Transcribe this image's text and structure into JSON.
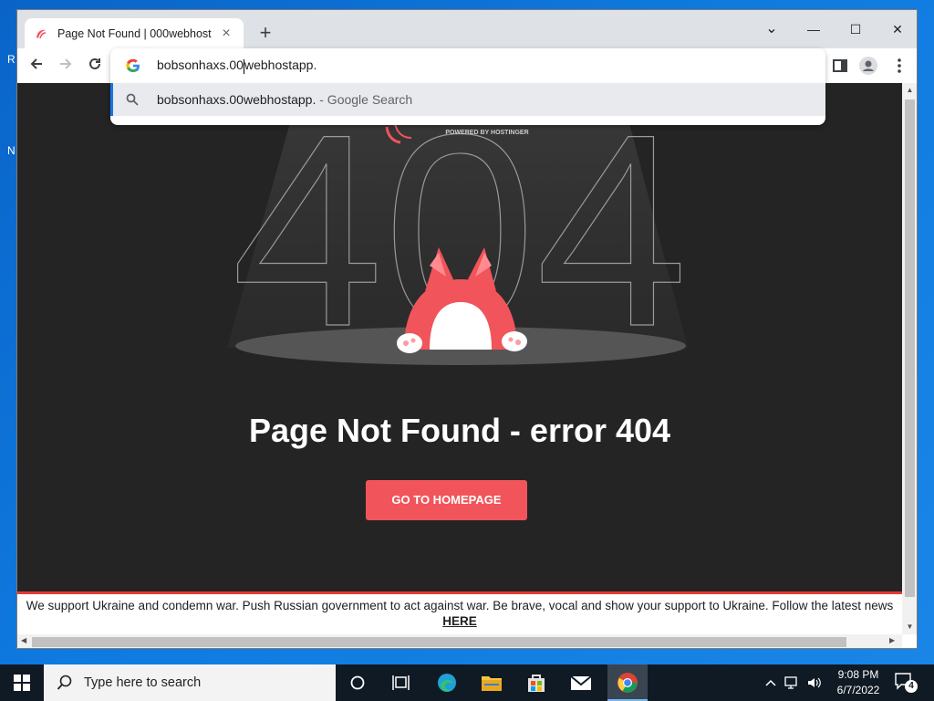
{
  "desktop": {
    "edge_letters": [
      "R",
      "N"
    ]
  },
  "browser": {
    "tab_title": "Page Not Found | 000webhost",
    "tab_close": "×",
    "new_tab": "+",
    "window_controls": {
      "minimize": "—",
      "maximize": "☐",
      "close": "✕",
      "tab_search": "⌄"
    },
    "omnibox": {
      "typed_before_caret": "bobsonhaxs.00",
      "typed_after_caret": "webhostapp.",
      "suggestion_query": "bobsonhaxs.00webhostapp.",
      "suggestion_source": " - Google Search"
    }
  },
  "page": {
    "brand_tagline": "POWERED BY HOSTINGER",
    "big_number": "404",
    "heading": "Page Not Found - error 404",
    "cta_label": "GO TO HOMEPAGE",
    "banner_text": "We support Ukraine and condemn war. Push Russian government to act against war. Be brave, vocal and show your support to Ukraine. Follow the latest news ",
    "banner_link": "HERE",
    "accent_color": "#f2545b"
  },
  "taskbar": {
    "search_placeholder": "Type here to search",
    "time": "9:08 PM",
    "date": "6/7/2022",
    "notification_count": "4"
  }
}
